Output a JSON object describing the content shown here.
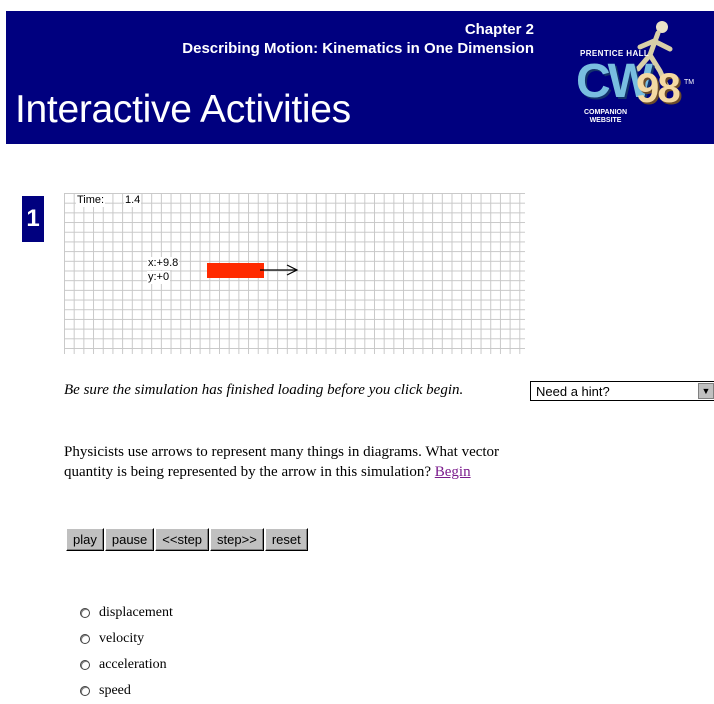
{
  "header": {
    "chapter": "Chapter 2",
    "chapter_title": "Describing Motion: Kinematics in One Dimension",
    "title": "Interactive Activities",
    "colors": {
      "banner": "#00007f"
    }
  },
  "logo": {
    "publisher": "PRENTICE HALL",
    "mark": "CW",
    "year": "98",
    "tm": "TM",
    "line1": "COMPANION",
    "line2": "WEBSITE"
  },
  "activity": {
    "number": "1",
    "simulation": {
      "time_label": "Time:",
      "time_value": "1.4",
      "x_readout": "x:+9.8",
      "y_readout": "y:+0",
      "box_color": "#ff2a00"
    },
    "note": "Be sure the simulation has finished loading before you click begin.",
    "question": "Physicists use arrows to represent many things in diagrams. What vector quantity is being represented by the arrow in this simulation?",
    "begin_link": "Begin",
    "hint_select": "Need a hint?",
    "controls": [
      "play",
      "pause",
      "<<step",
      "step>>",
      "reset"
    ],
    "options": [
      "displacement",
      "velocity",
      "acceleration",
      "speed"
    ]
  }
}
